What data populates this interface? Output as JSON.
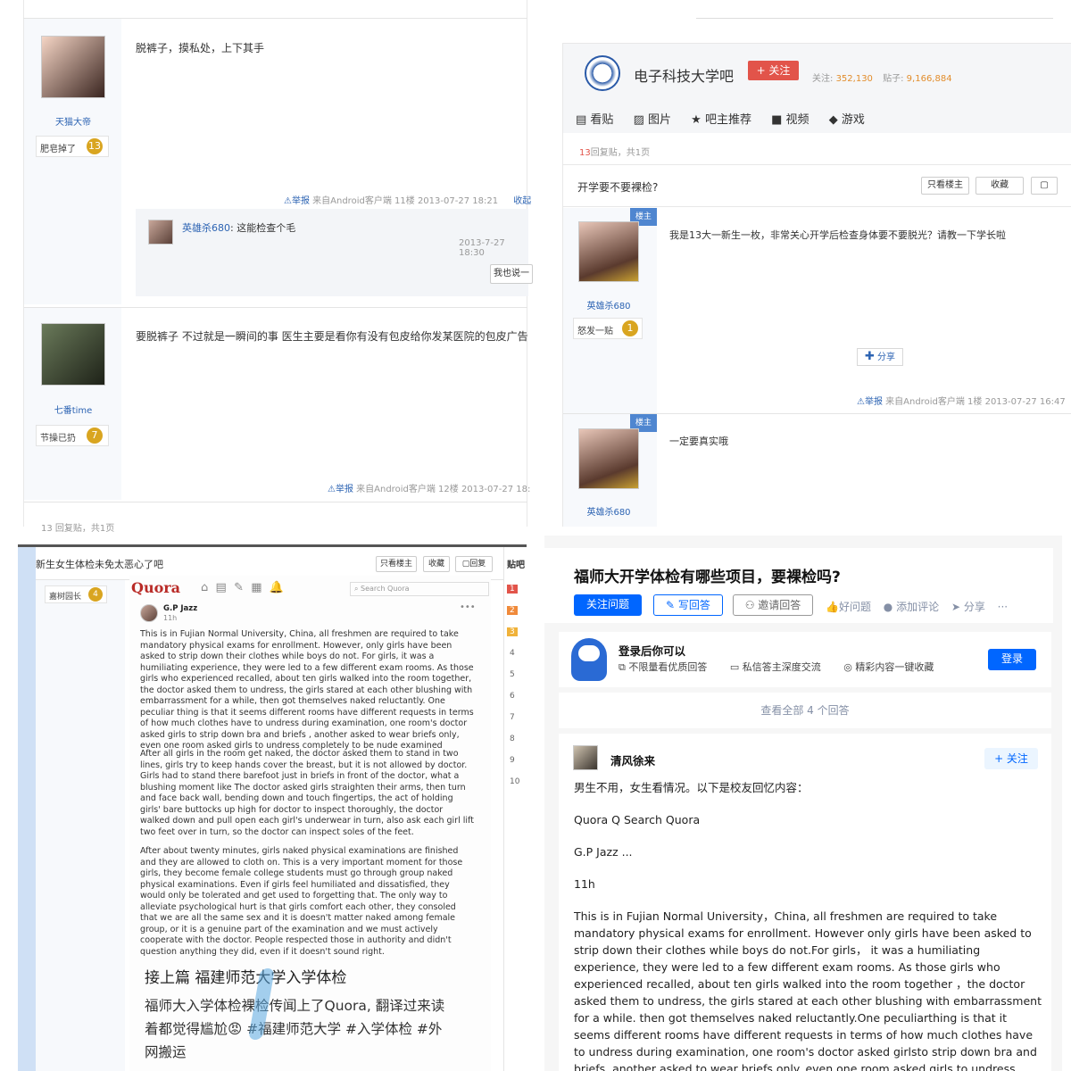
{
  "q1": {
    "post1": {
      "text": "脱裤子，摸私处，上下其手",
      "user": "天猫大帝",
      "badge_label": "肥皂掉了",
      "badge_level": "13",
      "report": "举报",
      "source": "来自Android客户端",
      "floor": "11楼",
      "time": "2013-07-27 18:21",
      "collect": "收起"
    },
    "reply": {
      "user": "英雄杀680",
      "text": ": 这能检查个毛",
      "time": "2013-7-27 18:30",
      "button": "我也说一"
    },
    "post2": {
      "text": "要脱裤子 不过就是一瞬间的事 医生主要是看你有没有包皮给你发某医院的包皮广告",
      "user": "七番time",
      "badge_label": "节操已扔",
      "badge_level": "7",
      "report": "举报",
      "source": "来自Android客户端",
      "floor": "12楼",
      "time": "2013-07-27 18:"
    },
    "footer": "13 回复贴，共1页"
  },
  "q2": {
    "forum_name": "电子科技大学吧",
    "follow": "+ 关注",
    "fans_label": "关注:",
    "fans": "352,130",
    "posts_label": "贴子:",
    "posts": "9,166,884",
    "tabs": [
      "看贴",
      "图片",
      "吧主推荐",
      "视频",
      "游戏"
    ],
    "reply_count": "13",
    "reply_text": "回复贴，共1页",
    "title": "开学要不要裸检?",
    "btn_only": "只看楼主",
    "btn_collect": "收藏",
    "post1": {
      "text": "我是13大一新生一枚，非常关心开学后检查身体要不要脱光？请教一下学长啦",
      "user": "英雄杀680",
      "badge_label": "怒发一贴",
      "badge_level": "1",
      "tag": "楼主",
      "share": "分享",
      "report": "举报",
      "source": "来自Android客户端",
      "floor": "1楼",
      "time": "2013-07-27 16:47"
    },
    "post2": {
      "text": "一定要真实哦",
      "user": "英雄杀680",
      "tag": "楼主"
    }
  },
  "q3": {
    "title": "新生女生体检未免太恶心了吧",
    "btn_only": "只看楼主",
    "btn_collect": "收藏",
    "btn_reply": "回复",
    "user_badge": "嘉树园长",
    "user_level": "4",
    "side_title": "贴吧",
    "side_nums": [
      "1",
      "2",
      "3",
      "4",
      "5",
      "6",
      "7",
      "8",
      "9",
      "10"
    ],
    "quora_logo": "Quora",
    "quora_search": "Search Quora",
    "quora_user": "G.P Jazz",
    "quora_time": "11h",
    "para1": "This is in Fujian Normal University, China, all freshmen are required to take mandatory physical exams for enrollment. However, only girls have been asked to strip down their clothes while boys do not. For girls, it was a humiliating experience, they were led to a few different exam rooms. As those girls who experienced recalled, about ten girls walked into the room together, the doctor asked them to undress, the girls stared at each other blushing with embarrassment for a while, then got themselves naked reluctantly. One peculiar thing is that it seems different rooms have different requests in terms of how much clothes have to undress during examination, one room's doctor asked girls to strip down bra and briefs , another asked to wear briefs only, even one room asked girls to undress completely to be nude examined",
    "para2": "After all girls in the room get naked, the doctor asked them to stand in two lines, girls try to keep hands cover the breast, but it is not allowed by doctor. Girls had to stand there barefoot just in briefs in front of the doctor, what a blushing moment like The doctor asked girls straighten their arms, then turn and face back wall, bending down and touch fingertips, the act of holding girls' bare buttocks up high for doctor to inspect thoroughly, the doctor walked down and pull open each girl's underwear in turn, also ask each girl lift two feet over in turn, so the doctor can inspect soles of the feet.",
    "para3": "After about twenty minutes, girls naked physical examinations are finished and they are allowed to cloth on. This is a very important moment for those girls, they become female college students must go through group naked physical examinations. Even if girls feel humiliated and dissatisfied, they would only be tolerated and get used to forgetting that. The only way to alleviate psychological hurt is that girls comfort each other, they consoled that we are all the same sex and it is doesn't matter naked among female group, or it is a genuine part of the examination and we must actively cooperate with the doctor. People respected those in authority and didn't question anything they did, even if it doesn't sound right.",
    "weibo_title": "接上篇 福建师范大学入学体检",
    "weibo_line1": "福师大入学体检裸检传闻上了Quora, 翻译过来读",
    "weibo_line2": "着都觉得尴尬😡 #福建师范大学 #入学体检 #外",
    "weibo_line3": "网搬运"
  },
  "q4": {
    "title": "福师大开学体检有哪些项目，要裸检吗?",
    "btn_follow": "关注问题",
    "btn_write": "写回答",
    "btn_invite": "邀请回答",
    "btn_good": "好问题",
    "btn_comment": "添加评论",
    "btn_share": "分享",
    "btn_more": "···",
    "login_title": "登录后你可以",
    "login_f1": "不限量看优质回答",
    "login_f2": "私信答主深度交流",
    "login_f3": "精彩内容一键收藏",
    "login_btn": "登录",
    "view_all": "查看全部 4 个回答",
    "author": "清风徐来",
    "author_follow": "+ 关注",
    "a1": "男生不用，女生看情况。以下是校友回忆内容：",
    "a2": "Quora Q Search Quora",
    "a3": "G.P Jazz ...",
    "a4": "11h",
    "a5": "This is in Fujian Normal University，China, all freshmen are required to take mandatory physical exams for enrollment. However only girls have been asked to strip down their clothes while boys do not.For girls， it was a humiliating experience, they were led to a few different exam rooms. As those girls who experienced recalled, about ten girls walked into the room together ，the doctor asked them to undress, the girls stared at each other blushing with embarrassment for a while. then got themselves naked reluctantly.One peculiarthing is that it seems different rooms have different requests in terms of how much clothes have to undress during examination, one room's doctor asked girlsto strip down bra and briefs, another asked to wear briefs only. even one room asked girls to undress completely to be nude examined"
  }
}
